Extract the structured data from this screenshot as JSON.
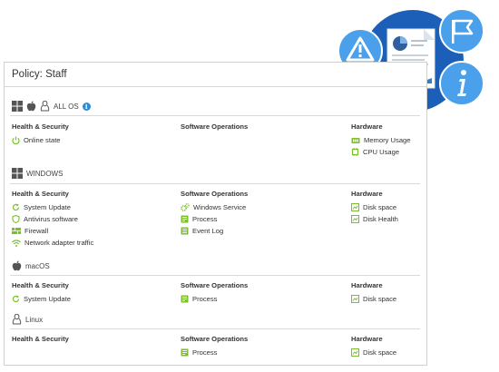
{
  "policy_title": "Policy: Staff",
  "column_headers": {
    "health": "Health & Security",
    "software": "Software Operations",
    "hardware": "Hardware"
  },
  "sections": {
    "all_os": {
      "label": "ALL OS",
      "health": [
        "Online state"
      ],
      "software": [],
      "hardware": [
        "Memory Usage",
        "CPU Usage"
      ]
    },
    "windows": {
      "label": "WINDOWS",
      "health": [
        "System Update",
        "Antivirus software",
        "Firewall",
        "Network adapter traffic"
      ],
      "software": [
        "Windows Service",
        "Process",
        "Event Log"
      ],
      "hardware": [
        "Disk space",
        "Disk Health"
      ]
    },
    "macos": {
      "label": "macOS",
      "health": [
        "System Update"
      ],
      "software": [
        "Process"
      ],
      "hardware": [
        "Disk space"
      ]
    },
    "linux": {
      "label": "Linux",
      "health": [],
      "software": [
        "Process"
      ],
      "hardware": [
        "Disk space"
      ]
    }
  },
  "colors": {
    "accent_green": "#7cbf2e",
    "info_blue": "#2a8bd6",
    "hero_blue": "#1c5fb8",
    "hero_light_blue": "#4aa0ea"
  },
  "icons": {
    "hero": [
      "warning-icon",
      "report-document-icon",
      "flag-icon",
      "info-icon"
    ]
  }
}
